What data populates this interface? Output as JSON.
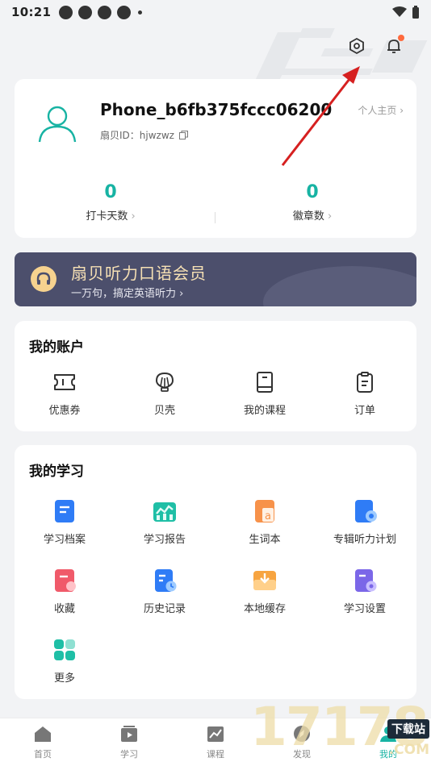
{
  "status_bar": {
    "time": "10:21"
  },
  "profile": {
    "username": "Phone_b6fb375fccc06200",
    "user_id_label": "扇贝ID：",
    "user_id": "hjwzwz",
    "homepage_link": "个人主页",
    "stats": [
      {
        "value": "0",
        "label": "打卡天数"
      },
      {
        "value": "0",
        "label": "徽章数"
      }
    ]
  },
  "vip_banner": {
    "title": "扇贝听力口语会员",
    "subtitle": "一万句，搞定英语听力"
  },
  "account": {
    "title": "我的账户",
    "items": [
      {
        "label": "优惠券",
        "icon": "ticket-icon"
      },
      {
        "label": "贝壳",
        "icon": "shell-icon"
      },
      {
        "label": "我的课程",
        "icon": "book-icon"
      },
      {
        "label": "订单",
        "icon": "clipboard-icon"
      }
    ]
  },
  "study": {
    "title": "我的学习",
    "items": [
      {
        "label": "学习档案",
        "icon": "archive-icon",
        "color": "#2f7cf6"
      },
      {
        "label": "学习报告",
        "icon": "report-chart-icon",
        "color": "#1fbfa6"
      },
      {
        "label": "生词本",
        "icon": "vocabulary-book-icon",
        "color": "#f7924a"
      },
      {
        "label": "专辑听力计划",
        "icon": "listening-plan-icon",
        "color": "#2f7cf6"
      },
      {
        "label": "收藏",
        "icon": "favorite-icon",
        "color": "#f05a6a"
      },
      {
        "label": "历史记录",
        "icon": "history-icon",
        "color": "#2f7cf6"
      },
      {
        "label": "本地缓存",
        "icon": "local-cache-icon",
        "color": "#f7a440"
      },
      {
        "label": "学习设置",
        "icon": "study-settings-icon",
        "color": "#7b67e8"
      },
      {
        "label": "更多",
        "icon": "more-grid-icon",
        "color": "#1fbfa6"
      }
    ]
  },
  "tabbar": {
    "tabs": [
      {
        "label": "首页",
        "icon": "home-icon"
      },
      {
        "label": "学习",
        "icon": "study-icon"
      },
      {
        "label": "课程",
        "icon": "course-icon"
      },
      {
        "label": "发现",
        "icon": "discover-icon"
      },
      {
        "label": "我的",
        "icon": "profile-icon"
      }
    ]
  },
  "watermark": {
    "number": "17178",
    "tag": "下载站",
    "domain": ".COM"
  }
}
